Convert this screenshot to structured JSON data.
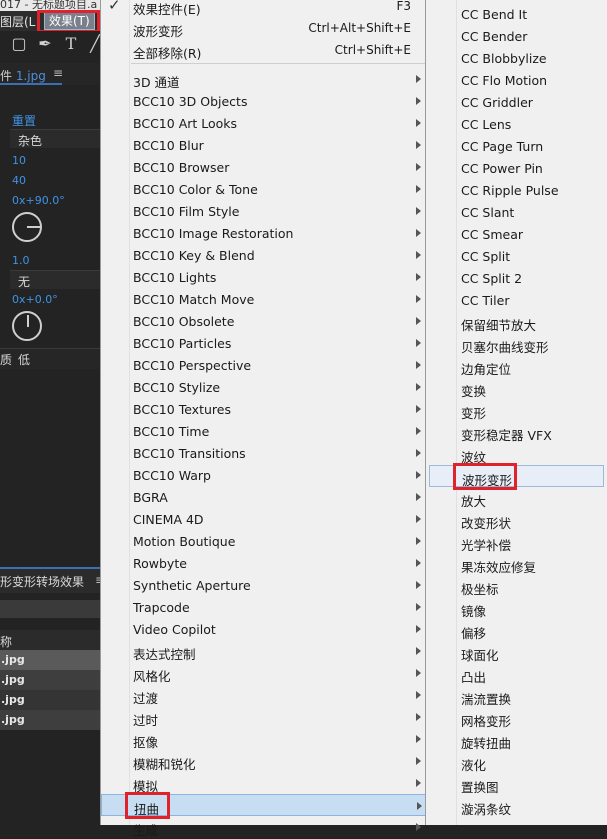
{
  "app": {
    "title_fragment": "017 - 无标题项目.a",
    "menubar": {
      "layer_label": "图层(L",
      "effect_label": "效果(T)"
    },
    "panel": {
      "tab_prefix": "件",
      "tab_file": "1.jpg",
      "tab_menu": "≡"
    },
    "properties": {
      "label_reset": "重置",
      "field_noise": "杂色",
      "value_10": "10",
      "value_40": "40",
      "angle_1": "0x+90.0°",
      "value_1_0": "1.0",
      "field_none": "无",
      "angle_2": "0x+0.0°",
      "quality_prefix": "质",
      "quality_value": "低"
    },
    "project": {
      "tab_label": "形变形转场效果",
      "tab_menu": "≡",
      "column_name": "称",
      "files": [
        ".jpg",
        ".jpg",
        ".jpg",
        ".jpg"
      ]
    }
  },
  "effect_menu": {
    "top_items": [
      {
        "label": "效果控件(E)",
        "shortcut": "F3",
        "checked": true
      },
      {
        "label": "波形变形",
        "shortcut": "Ctrl+Alt+Shift+E"
      },
      {
        "label": "全部移除(R)",
        "shortcut": "Ctrl+Shift+E"
      }
    ],
    "categories": [
      "3D 通道",
      "BCC10 3D Objects",
      "BCC10 Art Looks",
      "BCC10 Blur",
      "BCC10 Browser",
      "BCC10 Color & Tone",
      "BCC10 Film Style",
      "BCC10 Image Restoration",
      "BCC10 Key & Blend",
      "BCC10 Lights",
      "BCC10 Match Move",
      "BCC10 Obsolete",
      "BCC10 Particles",
      "BCC10 Perspective",
      "BCC10 Stylize",
      "BCC10 Textures",
      "BCC10 Time",
      "BCC10 Transitions",
      "BCC10 Warp",
      "BGRA",
      "CINEMA 4D",
      "Motion Boutique",
      "Rowbyte",
      "Synthetic Aperture",
      "Trapcode",
      "Video Copilot",
      "表达式控制",
      "风格化",
      "过渡",
      "过时",
      "抠像",
      "模糊和锐化",
      "模拟",
      "扭曲",
      "生成"
    ],
    "highlighted_category": "扭曲"
  },
  "distort_submenu": {
    "items": [
      "CC Bend It",
      "CC Bender",
      "CC Blobbylize",
      "CC Flo Motion",
      "CC Griddler",
      "CC Lens",
      "CC Page Turn",
      "CC Power Pin",
      "CC Ripple Pulse",
      "CC Slant",
      "CC Smear",
      "CC Split",
      "CC Split 2",
      "CC Tiler",
      "保留细节放大",
      "贝塞尔曲线变形",
      "边角定位",
      "变换",
      "变形",
      "变形稳定器 VFX",
      "波纹",
      "波形变形",
      "放大",
      "改变形状",
      "光学补偿",
      "果冻效应修复",
      "极坐标",
      "镜像",
      "偏移",
      "球面化",
      "凸出",
      "湍流置换",
      "网格变形",
      "旋转扭曲",
      "液化",
      "置换图",
      "漩涡条纹"
    ],
    "highlighted_item": "波形变形"
  },
  "colors": {
    "accent_red": "#e0232b",
    "highlight_blue": "#c7ddf1",
    "menu_bg": "#f0f0f0"
  }
}
